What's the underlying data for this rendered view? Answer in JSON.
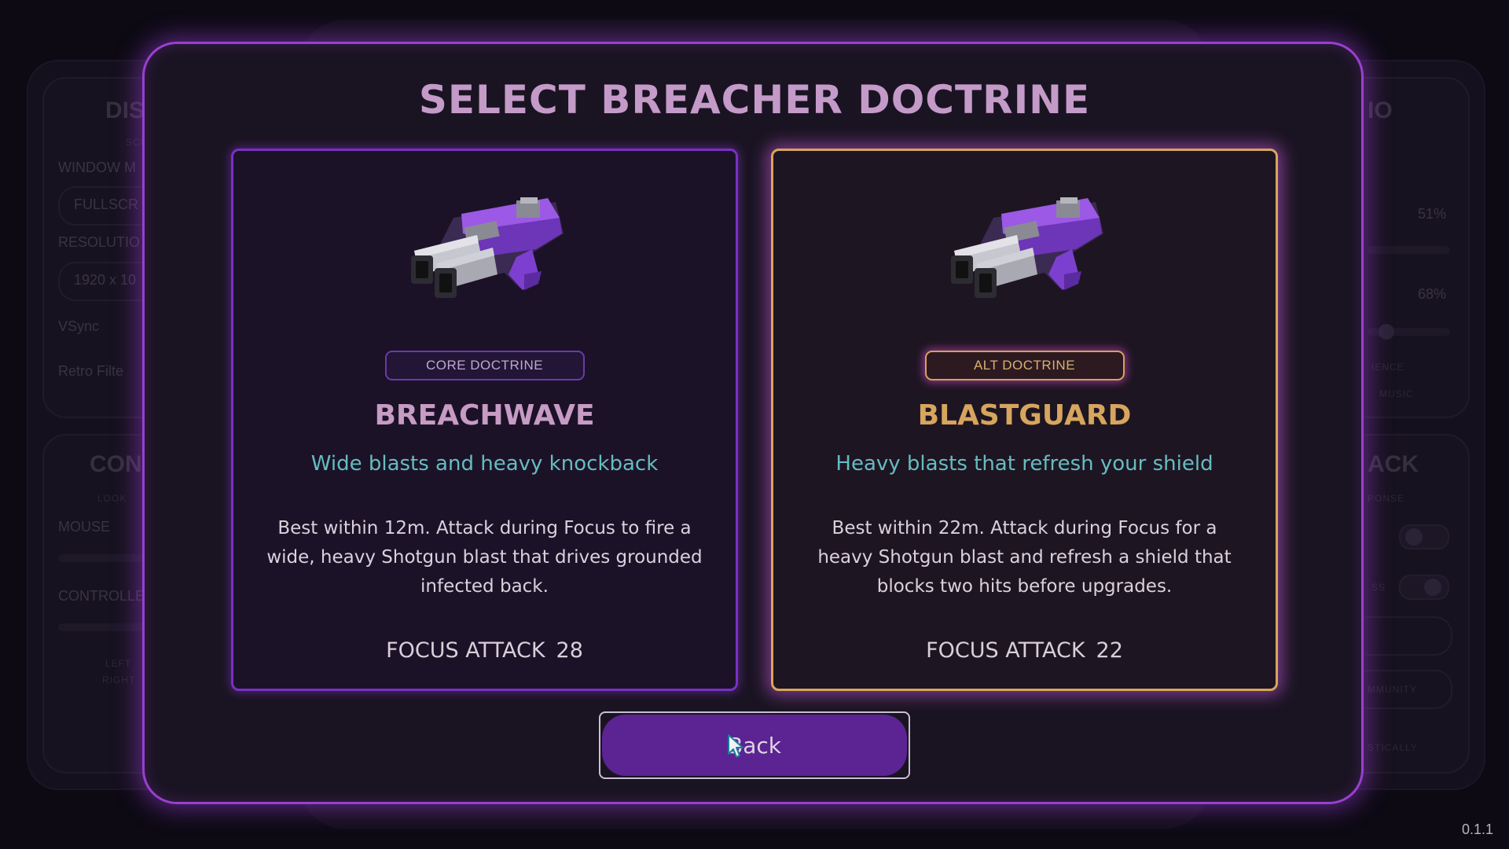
{
  "background": {
    "left_panel_heading_1": "DIS",
    "left_panel_sub_1": "SCRE",
    "window_mode_label": "WINDOW M",
    "window_mode_value": "FULLSCR",
    "resolution_label": "RESOLUTIO",
    "resolution_value": "1920 x 10",
    "vsync_label": "VSync",
    "retro_filter_label": "Retro Filte",
    "left_panel_heading_2": "CON",
    "left_panel_sub_2": "LOOK",
    "mouse_label": "MOUSE",
    "controller_label": "CONTROLLE",
    "left_small_1": "LEFT",
    "left_small_2": "RIGHT",
    "right_panel_heading_1": "IO",
    "right_pct_1": "51%",
    "right_pct_2": "68%",
    "right_small_1": "IENCE",
    "right_small_2": "MUSIC",
    "right_panel_heading_2": "ACK",
    "right_small_3": "PONSE",
    "right_small_4": "SS",
    "right_small_5": "MMUNITY",
    "right_small_6": "STICALLY"
  },
  "modal": {
    "title": "SELECT BREACHER DOCTRINE",
    "cards": [
      {
        "badge": "CORE DOCTRINE",
        "name": "BREACHWAVE",
        "tagline": "Wide blasts and heavy knockback",
        "description": "Best within 12m. Attack during Focus to fire a wide, heavy Shotgun blast that drives grounded infected back.",
        "stat_label": "FOCUS ATTACK",
        "stat_value": "28",
        "icon": "shotgun-icon"
      },
      {
        "badge": "ALT DOCTRINE",
        "name": "BLASTGUARD",
        "tagline": "Heavy blasts that refresh your shield",
        "description": "Best within 22m. Attack during Focus for a heavy Shotgun blast and refresh a shield that blocks two hits before upgrades.",
        "stat_label": "FOCUS ATTACK",
        "stat_value": "22",
        "icon": "shotgun-icon"
      }
    ],
    "back_label": "Back"
  },
  "version": "0.1.1",
  "colors": {
    "accent_purple": "#9a3fd0",
    "alt_gold": "#d6a55e",
    "tagline_teal": "#66bcc0"
  }
}
